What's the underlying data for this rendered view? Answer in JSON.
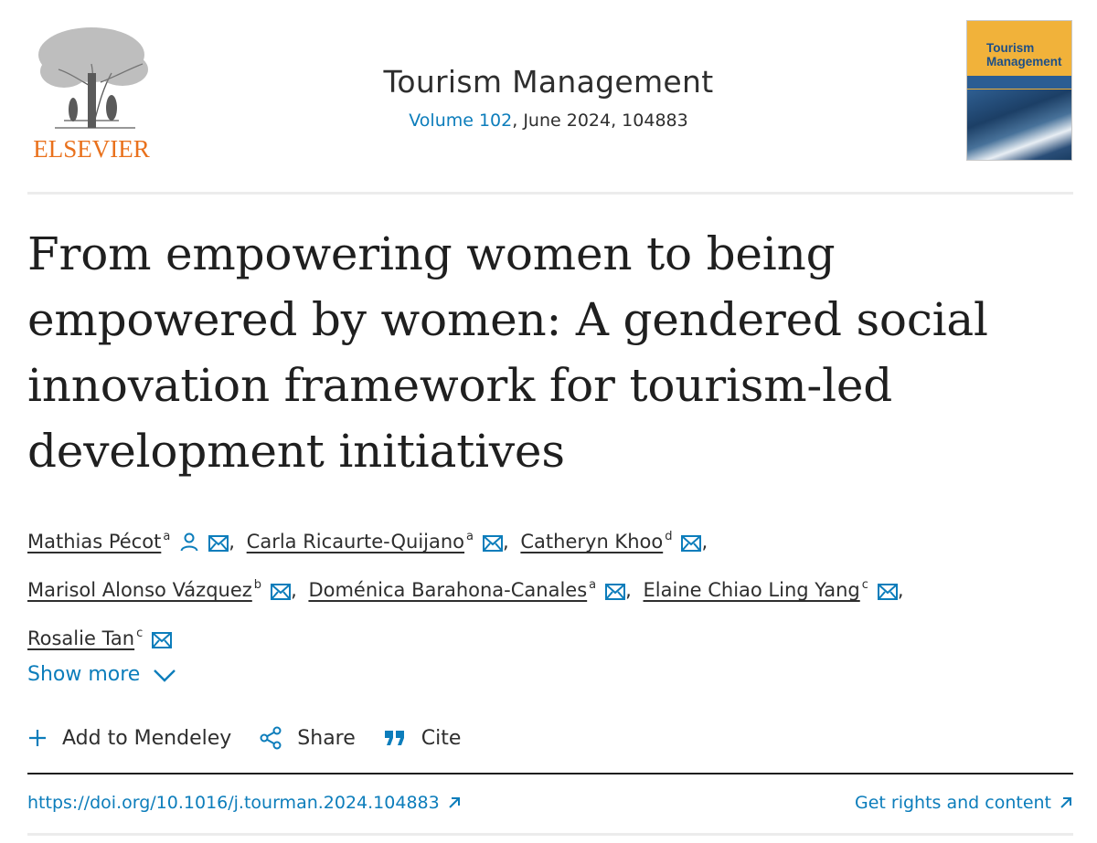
{
  "publisher": {
    "name": "ELSEVIER",
    "brand_color": "#e9711c"
  },
  "journal": {
    "title": "Tourism Management",
    "volume_link": "Volume 102",
    "issue_info": ", June 2024, 104883",
    "cover_title_line1": "Tourism",
    "cover_title_line2": "Management"
  },
  "article": {
    "title": "From empowering women to being empowered by women: A gendered social innovation framework for tourism-led development initiatives"
  },
  "authors": [
    {
      "name": "Mathias Pécot",
      "aff": "a",
      "sep": ","
    },
    {
      "name": "Carla Ricaurte-Quijano",
      "aff": "a",
      "sep": ","
    },
    {
      "name": "Catheryn Khoo",
      "aff": "d",
      "sep": ","
    },
    {
      "name": "Marisol Alonso Vázquez",
      "aff": "b",
      "sep": ","
    },
    {
      "name": "Doménica Barahona-Canales",
      "aff": "a",
      "sep": ","
    },
    {
      "name": "Elaine Chiao Ling Yang",
      "aff": "c",
      "sep": ","
    },
    {
      "name": "Rosalie Tan",
      "aff": "c",
      "sep": ""
    }
  ],
  "controls": {
    "show_more": "Show more",
    "add_to_mendeley": "Add to Mendeley",
    "share": "Share",
    "cite": "Cite"
  },
  "links": {
    "doi": "https://doi.org/10.1016/j.tourman.2024.104883",
    "rights": "Get rights and content"
  },
  "colors": {
    "link": "#0c7dbb",
    "text": "#1f1f1f"
  },
  "icons": [
    "person-icon",
    "envelope-icon",
    "chevron-down-icon",
    "plus-icon",
    "share-icon",
    "quote-icon",
    "external-link-icon"
  ]
}
